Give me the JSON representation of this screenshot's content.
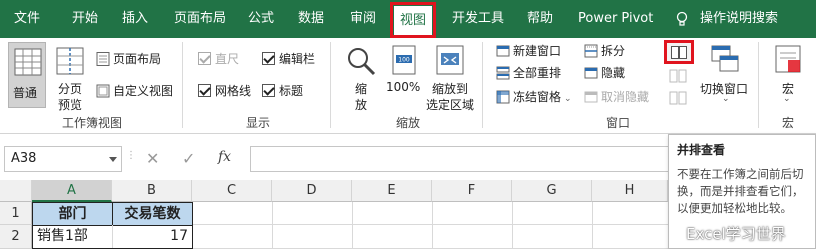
{
  "menu": {
    "items": [
      "文件",
      "开始",
      "插入",
      "页面布局",
      "公式",
      "数据",
      "审阅",
      "视图",
      "开发工具",
      "帮助",
      "Power Pivot",
      "操作说明搜索"
    ],
    "active": "视图"
  },
  "ribbon": {
    "workbook_views": {
      "normal": "普通",
      "page_break_preview_l1": "分页",
      "page_break_preview_l2": "预览",
      "page_layout": "页面布局",
      "custom_views": "自定义视图",
      "label": "工作簿视图"
    },
    "show": {
      "ruler": "直尺",
      "formula_bar": "编辑栏",
      "gridlines": "网格线",
      "headings": "标题",
      "label": "显示"
    },
    "zoom": {
      "zoom_l1": "缩",
      "zoom_l2": "放",
      "hundred": "100%",
      "to_selection_l1": "缩放到",
      "to_selection_l2": "选定区域",
      "label": "缩放"
    },
    "window": {
      "new_window": "新建窗口",
      "arrange_all": "全部重排",
      "freeze_panes": "冻结窗格",
      "split": "拆分",
      "hide": "隐藏",
      "unhide": "取消隐藏",
      "switch_windows": "切换窗口",
      "label": "窗口"
    },
    "macros": {
      "macros": "宏",
      "label": "宏"
    }
  },
  "formula_bar": {
    "name_box": "A38",
    "fx": "fx",
    "cancel": "✕",
    "enter": "✓"
  },
  "grid": {
    "columns": [
      "A",
      "B",
      "C",
      "D",
      "E",
      "F",
      "G",
      "H"
    ],
    "rows": [
      "1",
      "2"
    ],
    "cells": {
      "a1": "部门",
      "b1": "交易笔数",
      "a2": "销售1部",
      "b2": "17"
    }
  },
  "tooltip": {
    "title": "并排查看",
    "body": "不要在工作簿之间前后切换，而是并排查看它们，以便更加轻松地比较。"
  },
  "watermark": "Excel学习世界",
  "colors": {
    "brand": "#217346",
    "highlight": "#e0141e",
    "header_fill": "#bdd7ee"
  }
}
